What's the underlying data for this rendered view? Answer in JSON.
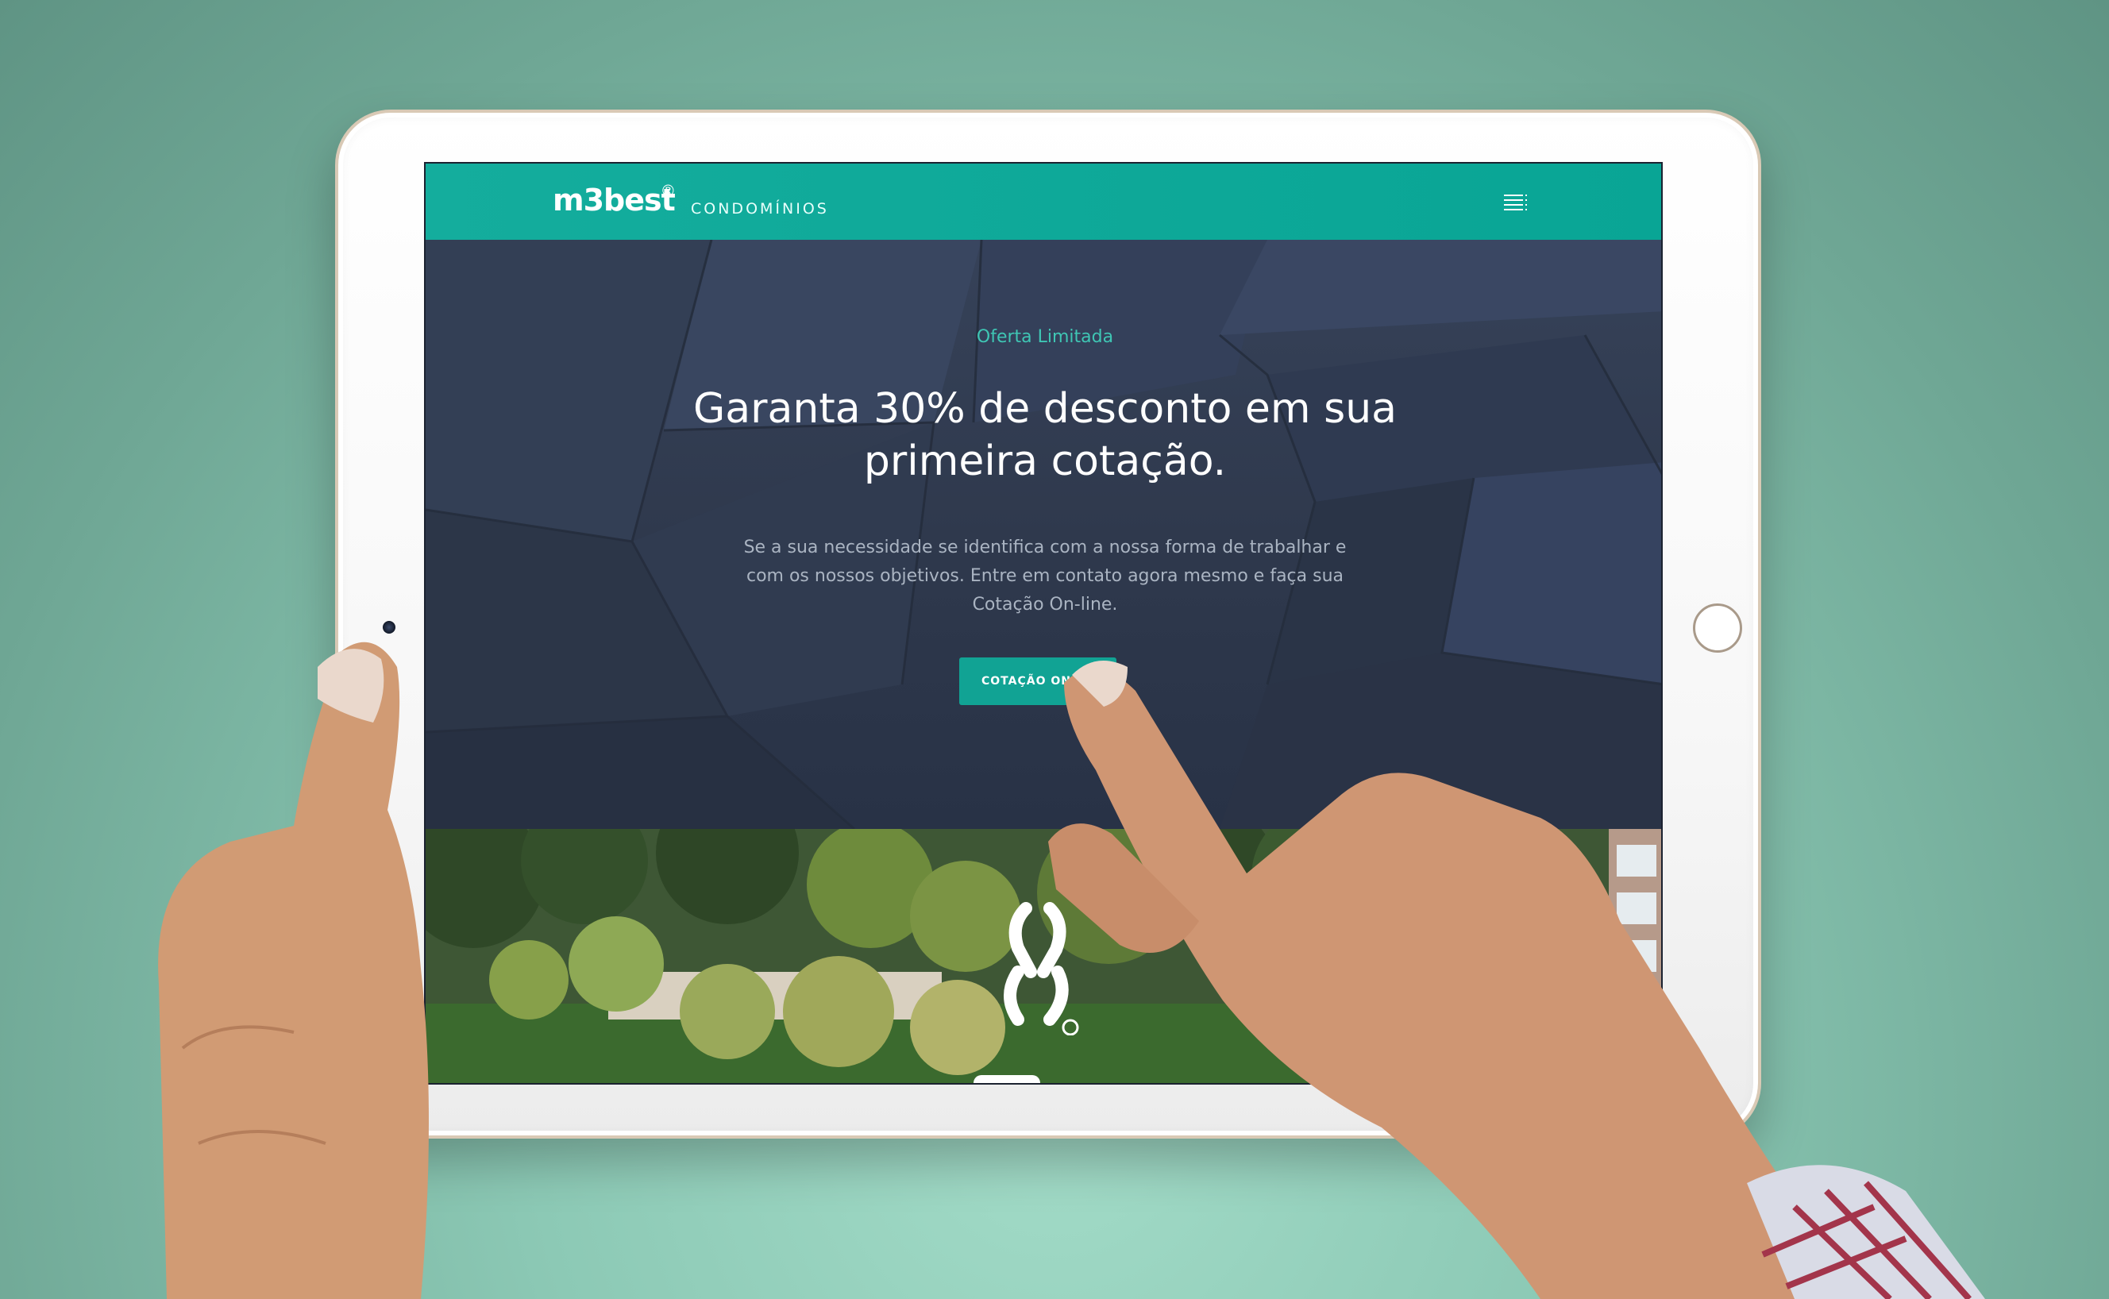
{
  "brand": {
    "logo_text": "m3best",
    "logo_reg": "®",
    "logo_sub": "CONDOMÍNIOS"
  },
  "hero": {
    "eyebrow": "Oferta Limitada",
    "title": "Garanta 30% de desconto em sua primeira cotação.",
    "text": "Se a sua necessidade se identifica com a nossa forma de trabalhar e com os nossos objetivos. Entre em contato agora mesmo e faça sua Cotação On-line.",
    "cta_label": "COTAÇÃO ON"
  },
  "icons": {
    "menu": "menu-icon",
    "brand_mark": "m3best-mark-icon"
  },
  "colors": {
    "accent": "#11a394",
    "hero_bg": "#2f394d",
    "eyebrow": "#3fc6b4"
  }
}
